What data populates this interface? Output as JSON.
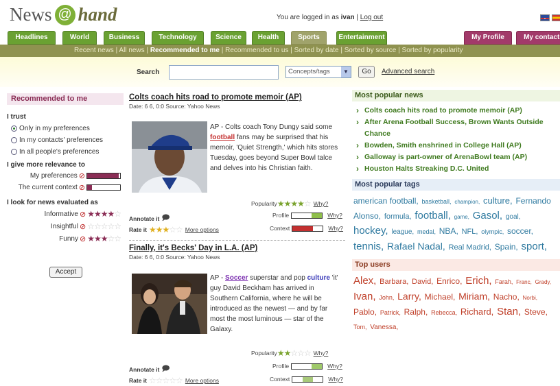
{
  "header": {
    "logo_news": "News",
    "logo_at": "@",
    "logo_hand": "hand",
    "login_prefix": "You are logged in as",
    "user": "ivan",
    "logout": "Log out"
  },
  "tabs": [
    {
      "label": "Headlines"
    },
    {
      "label": "World"
    },
    {
      "label": "Business"
    },
    {
      "label": "Technology"
    },
    {
      "label": "Science"
    },
    {
      "label": "Health"
    },
    {
      "label": "Sports"
    },
    {
      "label": "Entertainment"
    },
    {
      "label": "My Profile"
    },
    {
      "label": "My contacts"
    }
  ],
  "subnav": {
    "recent": "Recent news",
    "all": "All news",
    "recommended_me": "Recommended to me",
    "recommended_us": "Recommended to us",
    "by_date": "Sorted by date",
    "by_source": "Sorted by source",
    "by_popularity": "Sorted by popularity"
  },
  "search": {
    "label": "Search",
    "select_value": "Concepts/tags",
    "go": "Go",
    "advanced": "Advanced search"
  },
  "sidebar": {
    "title": "Recommended to me",
    "trust_label": "I trust",
    "trust_options": [
      "Only in my preferences",
      "In my contacts' preferences",
      "In all people's preferences"
    ],
    "relevance_label": "I give more relevance to",
    "relevance_rows": [
      {
        "label": "My preferences",
        "level": 0.95
      },
      {
        "label": "The current context",
        "level": 0.15
      }
    ],
    "eval_label": "I look for news evaluated as",
    "eval_rows": [
      {
        "label": "Informative",
        "stars": 4
      },
      {
        "label": "Insightful",
        "stars": 0
      },
      {
        "label": "Funny",
        "stars": 3
      }
    ],
    "accept": "Accept"
  },
  "articles": [
    {
      "title": "Colts coach hits road to promote memoir (AP)",
      "meta": "Date: 6 6, 0:0 Source: Yahoo News",
      "body_pre": "AP - Colts coach Tony Dungy said some ",
      "body_hl": "football",
      "body_post": " fans may be surprised that his memoir, 'Quiet Strength,' which hits stores Tuesday, goes beyond Super Bowl talce and delves into his Christian faith.",
      "popularity_label": "Popularity",
      "popularity": 4,
      "why": "Why?",
      "annotate": "Annotate it",
      "rate": "Rate it",
      "rate_stars": 3,
      "more_options": "More options",
      "profile_label": "Profile",
      "context_label": "Context",
      "colors": {
        "profile_fill": "#8fbf4a",
        "context_fill": "#c43030"
      }
    },
    {
      "title": "Finally, it's Becks' Day in L.A. (AP)",
      "meta": "Date: 6 6, 0:0 Source: Yahoo News",
      "body_pre": "AP - ",
      "body_hl": "Soccer",
      "body_mid": " superstar and pop ",
      "body_hl2": "culture",
      "body_post": " 'it' guy David Beckham has arrived in Southern California, where he will be introduced as the newest — and by far most the most luminous — star of the Galaxy.",
      "popularity_label": "Popularity",
      "popularity": 2,
      "why": "Why?",
      "annotate": "Annotate it",
      "rate": "Rate it",
      "rate_stars": 0,
      "more_options": "More options",
      "profile_label": "Profile",
      "context_label": "Context",
      "colors": {
        "profile_fill": "#9fc96a",
        "context_fill": "#a8c97a"
      }
    }
  ],
  "popular_news": {
    "title": "Most popular news",
    "items": [
      "Colts coach hits road to promote memoir (AP)",
      "After Arena Football Success, Brown Wants Outside Chance",
      "Bowden, Smith enshrined in College Hall (AP)",
      "Galloway is part-owner of ArenaBowl team (AP)",
      "Houston Halts Streaking D.C. United"
    ]
  },
  "popular_tags": {
    "title": "Most popular tags",
    "tags": [
      {
        "t": "american football",
        "s": 12
      },
      {
        "t": "basketball",
        "s": 9
      },
      {
        "t": "champion",
        "s": 8
      },
      {
        "t": "culture",
        "s": 13
      },
      {
        "t": "Fernando Alonso",
        "s": 12
      },
      {
        "t": "formula",
        "s": 11
      },
      {
        "t": "football",
        "s": 15
      },
      {
        "t": "game",
        "s": 8
      },
      {
        "t": "Gasol",
        "s": 15
      },
      {
        "t": "goal",
        "s": 10
      },
      {
        "t": "hockey",
        "s": 15
      },
      {
        "t": "league",
        "s": 10
      },
      {
        "t": "medal",
        "s": 9
      },
      {
        "t": "NBA",
        "s": 12
      },
      {
        "t": "NFL",
        "s": 11
      },
      {
        "t": "olympic",
        "s": 9
      },
      {
        "t": "soccer",
        "s": 12
      },
      {
        "t": "tennis",
        "s": 15
      },
      {
        "t": "Rafael Nadal",
        "s": 14
      },
      {
        "t": "Real Madrid",
        "s": 11
      },
      {
        "t": "Spain",
        "s": 12
      },
      {
        "t": "sport",
        "s": 15
      }
    ]
  },
  "top_users": {
    "title": "Top users",
    "users": [
      {
        "t": "Alex",
        "s": 15
      },
      {
        "t": "Barbara",
        "s": 11
      },
      {
        "t": "David",
        "s": 11
      },
      {
        "t": "Enrico",
        "s": 12
      },
      {
        "t": "Erich",
        "s": 15
      },
      {
        "t": "Farah",
        "s": 9
      },
      {
        "t": "Franc",
        "s": 8
      },
      {
        "t": "Grady",
        "s": 8
      },
      {
        "t": "Ivan",
        "s": 15
      },
      {
        "t": "John",
        "s": 9
      },
      {
        "t": "Larry",
        "s": 14
      },
      {
        "t": "Michael",
        "s": 12
      },
      {
        "t": "Miriam",
        "s": 14
      },
      {
        "t": "Nacho",
        "s": 12
      },
      {
        "t": "Norbi",
        "s": 8
      },
      {
        "t": "Pablo",
        "s": 12
      },
      {
        "t": "Patrick",
        "s": 9
      },
      {
        "t": "Ralph",
        "s": 12
      },
      {
        "t": "Rebecca",
        "s": 9
      },
      {
        "t": "Richard",
        "s": 13
      },
      {
        "t": "Stan",
        "s": 15
      },
      {
        "t": "Steve",
        "s": 12
      },
      {
        "t": "Tom",
        "s": 9
      },
      {
        "t": "Vanessa",
        "s": 10
      }
    ]
  }
}
